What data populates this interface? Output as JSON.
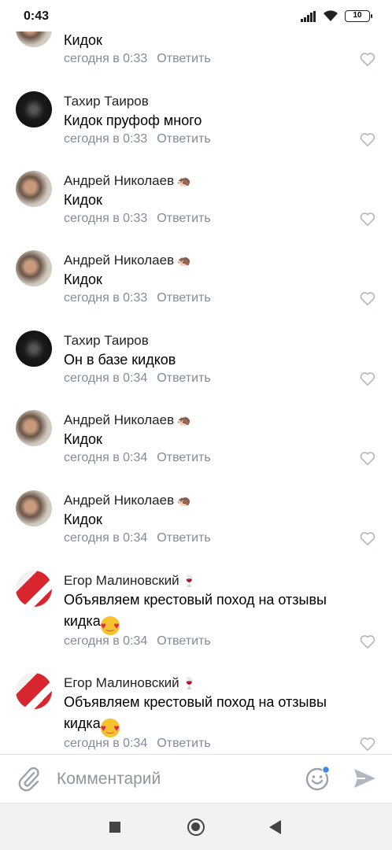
{
  "status_bar": {
    "time": "0:43",
    "battery": "10"
  },
  "comments": [
    {
      "name": "",
      "badge": "",
      "text": "Кидок",
      "time": "сегодня в 0:33",
      "reply": "Ответить",
      "avatar": "andrey"
    },
    {
      "name": "Тахир Таиров",
      "badge": "",
      "text": "Кидок пруфоф много",
      "time": "сегодня в 0:33",
      "reply": "Ответить",
      "avatar": "tahir"
    },
    {
      "name": "Андрей Николаев",
      "badge": "hedgehog",
      "text": "Кидок",
      "time": "сегодня в 0:33",
      "reply": "Ответить",
      "avatar": "andrey"
    },
    {
      "name": "Андрей Николаев",
      "badge": "hedgehog",
      "text": "Кидок",
      "time": "сегодня в 0:33",
      "reply": "Ответить",
      "avatar": "andrey"
    },
    {
      "name": "Тахир Таиров",
      "badge": "",
      "text": "Он в базе кидков",
      "time": "сегодня в 0:34",
      "reply": "Ответить",
      "avatar": "tahir"
    },
    {
      "name": "Андрей Николаев",
      "badge": "hedgehog",
      "text": "Кидок",
      "time": "сегодня в 0:34",
      "reply": "Ответить",
      "avatar": "andrey"
    },
    {
      "name": "Андрей Николаев",
      "badge": "hedgehog",
      "text": "Кидок",
      "time": "сегодня в 0:34",
      "reply": "Ответить",
      "avatar": "andrey"
    },
    {
      "name": "Егор Малиновский",
      "badge": "wine-glass",
      "text_line1": "Объявляем крестовый поход на отзывы",
      "text_line2": "кидка",
      "text_emoji": "heart-eyes",
      "time": "сегодня в 0:34",
      "reply": "Ответить",
      "avatar": "egor"
    },
    {
      "name": "Егор Малиновский",
      "badge": "wine-glass",
      "text_line1": "Объявляем крестовый поход на отзывы",
      "text_line2": "кидка",
      "text_emoji": "heart-eyes",
      "time": "сегодня в 0:34",
      "reply": "Ответить",
      "avatar": "egor"
    }
  ],
  "composer": {
    "placeholder": "Комментарий",
    "value": ""
  },
  "colors": {
    "meta_text": "#818c99",
    "like_icon": "#aeb7c2",
    "send_icon": "#aeb7c2",
    "smile_badge": "#3f8ae0"
  },
  "icons": [
    "paperclip-icon",
    "smile-icon",
    "send-icon",
    "heart-icon",
    "nav-recent-icon",
    "nav-home-icon",
    "nav-back-icon",
    "hedgehog-icon",
    "wine-glass-icon",
    "heart-eyes-emoji"
  ]
}
